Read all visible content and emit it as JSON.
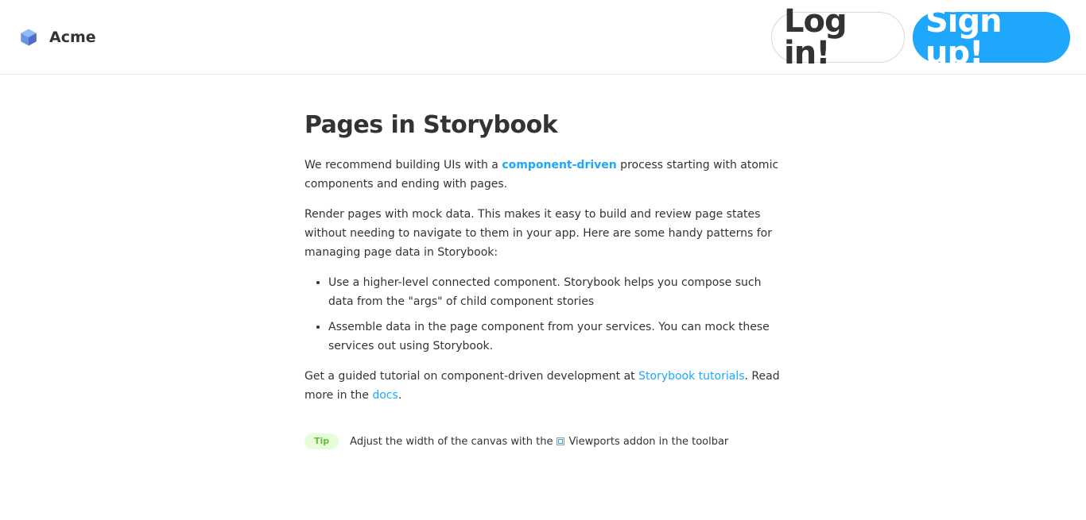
{
  "header": {
    "brand": "Acme",
    "login_label": "Log in!",
    "signup_label": "Sign up!"
  },
  "content": {
    "title": "Pages in Storybook",
    "p1_before": "We recommend building UIs with a ",
    "p1_link": "component-driven",
    "p1_after": " process starting with atomic components and ending with pages.",
    "p2": "Render pages with mock data. This makes it easy to build and review page states without needing to navigate to them in your app. Here are some handy patterns for managing page data in Storybook:",
    "list": [
      "Use a higher-level connected component. Storybook helps you compose such data from the \"args\" of child component stories",
      "Assemble data in the page component from your services. You can mock these services out using Storybook."
    ],
    "p3_before": "Get a guided tutorial on component-driven development at ",
    "p3_link1": "Storybook tutorials",
    "p3_middle": ". Read more in the ",
    "p3_link2": "docs",
    "p3_after": "."
  },
  "tip": {
    "badge": "Tip",
    "text_before": "Adjust the width of the canvas with the ",
    "text_after": "Viewports addon in the toolbar"
  },
  "colors": {
    "accent": "#1ea7fd",
    "text": "#333333",
    "tip_bg": "#e7fdd8",
    "tip_text": "#66bf3c"
  },
  "icons": {
    "brand_logo": "cube-logo-icon",
    "viewport": "viewport-icon"
  }
}
